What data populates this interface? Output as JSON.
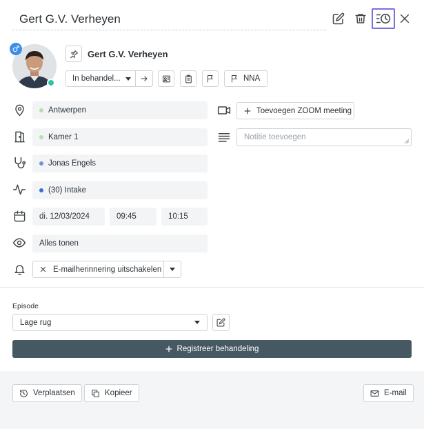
{
  "header": {
    "title": "Gert G.V. Verheyen"
  },
  "patient": {
    "name": "Gert G.V. Verheyen",
    "gender_symbol": "♂",
    "status": "In behandel...",
    "flag_label": "NNA"
  },
  "fields": {
    "location": "Antwerpen",
    "room": "Kamer 1",
    "therapist": "Jonas Engels",
    "appointment_type": "(30) Intake",
    "date": "di. 12/03/2024",
    "start_time": "09:45",
    "end_time": "10:15",
    "visibility": "Alles tonen",
    "reminder": "E-mailherinnering uitschakelen"
  },
  "side": {
    "zoom_label": "Toevoegen ZOOM meeting",
    "notes_placeholder": "Notitie toevoegen"
  },
  "episode": {
    "label": "Episode",
    "value": "Lage rug"
  },
  "register_label": "Registreer behandeling",
  "footer": {
    "move_label": "Verplaatsen",
    "copy_label": "Kopieer",
    "email_label": "E-mail"
  },
  "colors": {
    "accent_active_outline": "#7b6fe0",
    "dot_green": "#b7dcb0",
    "dot_blue": "#6f93d6",
    "dot_dark_blue": "#3b6fd1",
    "online": "#28c7a0",
    "gender": "#3d8de8",
    "primary_button": "#465862"
  },
  "icons": [
    "edit-icon",
    "trash-icon",
    "history-icon",
    "close-icon",
    "pin-icon",
    "arrow-right-icon",
    "contact-card-icon",
    "clipboard-icon",
    "flag-icon",
    "location-icon",
    "door-icon",
    "stethoscope-icon",
    "activity-icon",
    "calendar-icon",
    "eye-icon",
    "bell-icon",
    "video-icon",
    "text-lines-icon",
    "plus-icon",
    "x-icon",
    "caret-down-icon",
    "pencil-icon",
    "clock-rotate-icon",
    "copy-icon",
    "mail-icon"
  ]
}
